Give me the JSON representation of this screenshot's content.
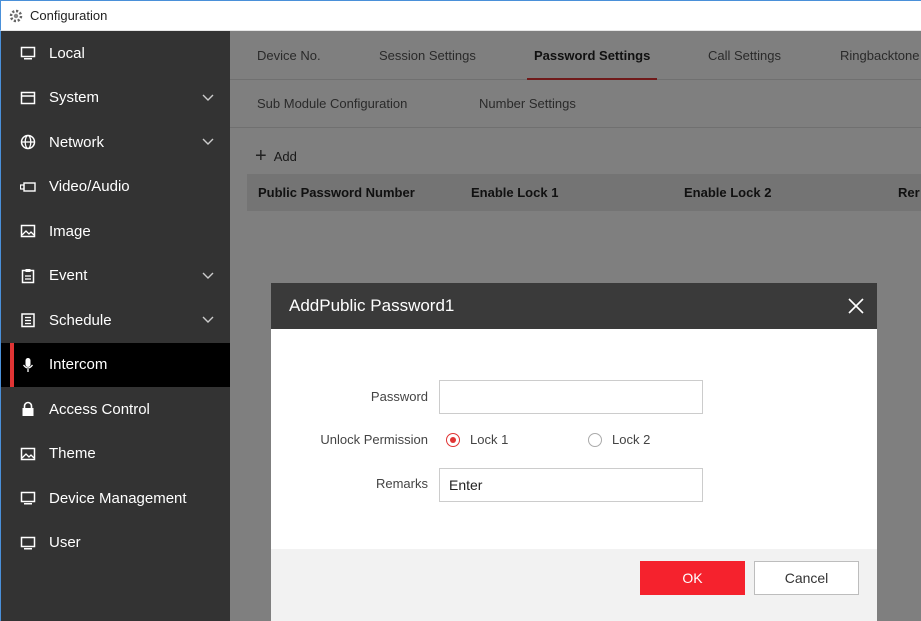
{
  "window": {
    "title": "Configuration",
    "icon": "gear-icon"
  },
  "sidebar": {
    "items": [
      {
        "label": "Local",
        "icon": "monitor-icon",
        "expandable": false
      },
      {
        "label": "System",
        "icon": "window-icon",
        "expandable": true
      },
      {
        "label": "Network",
        "icon": "globe-icon",
        "expandable": true
      },
      {
        "label": "Video/Audio",
        "icon": "camera-icon",
        "expandable": false
      },
      {
        "label": "Image",
        "icon": "picture-icon",
        "expandable": false
      },
      {
        "label": "Event",
        "icon": "clipboard-icon",
        "expandable": true
      },
      {
        "label": "Schedule",
        "icon": "calendar-icon",
        "expandable": true
      },
      {
        "label": "Intercom",
        "icon": "microphone-icon",
        "expandable": false,
        "active": true
      },
      {
        "label": "Access Control",
        "icon": "lock-icon",
        "expandable": false
      },
      {
        "label": "Theme",
        "icon": "picture-icon",
        "expandable": false
      },
      {
        "label": "Device Management",
        "icon": "monitor-icon",
        "expandable": false
      },
      {
        "label": "User",
        "icon": "monitor-icon",
        "expandable": false
      }
    ]
  },
  "tabs": {
    "row1": [
      "Device No.",
      "Session Settings",
      "Password Settings",
      "Call Settings",
      "Ringbacktone"
    ],
    "row2": [
      "Sub Module Configuration",
      "Number Settings"
    ],
    "active": "Password Settings"
  },
  "toolbar": {
    "add_label": "Add"
  },
  "table": {
    "columns": [
      "Public Password Number",
      "Enable Lock 1",
      "Enable Lock 2",
      "Rer"
    ]
  },
  "dialog": {
    "title": "AddPublic Password1",
    "password_label": "Password",
    "password_value": "",
    "unlock_label": "Unlock Permission",
    "lock1_label": "Lock 1",
    "lock2_label": "Lock 2",
    "lock1_checked": true,
    "lock2_checked": false,
    "remarks_label": "Remarks",
    "remarks_value": "Enter",
    "ok_label": "OK",
    "cancel_label": "Cancel"
  },
  "colors": {
    "accent": "#f5222d",
    "sidebar_bg": "#333333",
    "active_bar": "#e03434"
  }
}
